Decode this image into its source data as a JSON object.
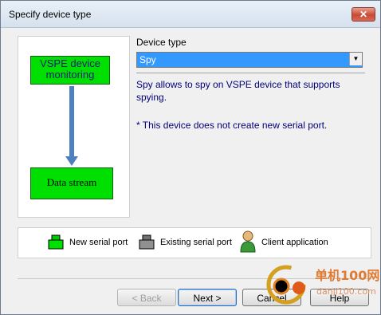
{
  "window": {
    "title": "Specify device type",
    "close_glyph": "✕"
  },
  "diagram": {
    "top_box": "VSPE device monitoring",
    "bottom_box": "Data stream"
  },
  "device_type": {
    "label": "Device type",
    "selected": "Spy"
  },
  "description": {
    "main": "Spy allows to spy on VSPE device that supports spying.",
    "note": "* This device does not create new serial port."
  },
  "legend": {
    "new_port": "New serial port",
    "existing_port": "Existing serial port",
    "client_app": "Client application"
  },
  "buttons": {
    "back": "< Back",
    "next": "Next >",
    "cancel": "Cancel",
    "help": "Help"
  },
  "watermark": {
    "line1": "单机100网",
    "line2": "danji100.com"
  },
  "colors": {
    "accent": "#3399ff",
    "box_green": "#00e000",
    "text_blue": "#00007a",
    "arrow": "#4e80c0"
  }
}
